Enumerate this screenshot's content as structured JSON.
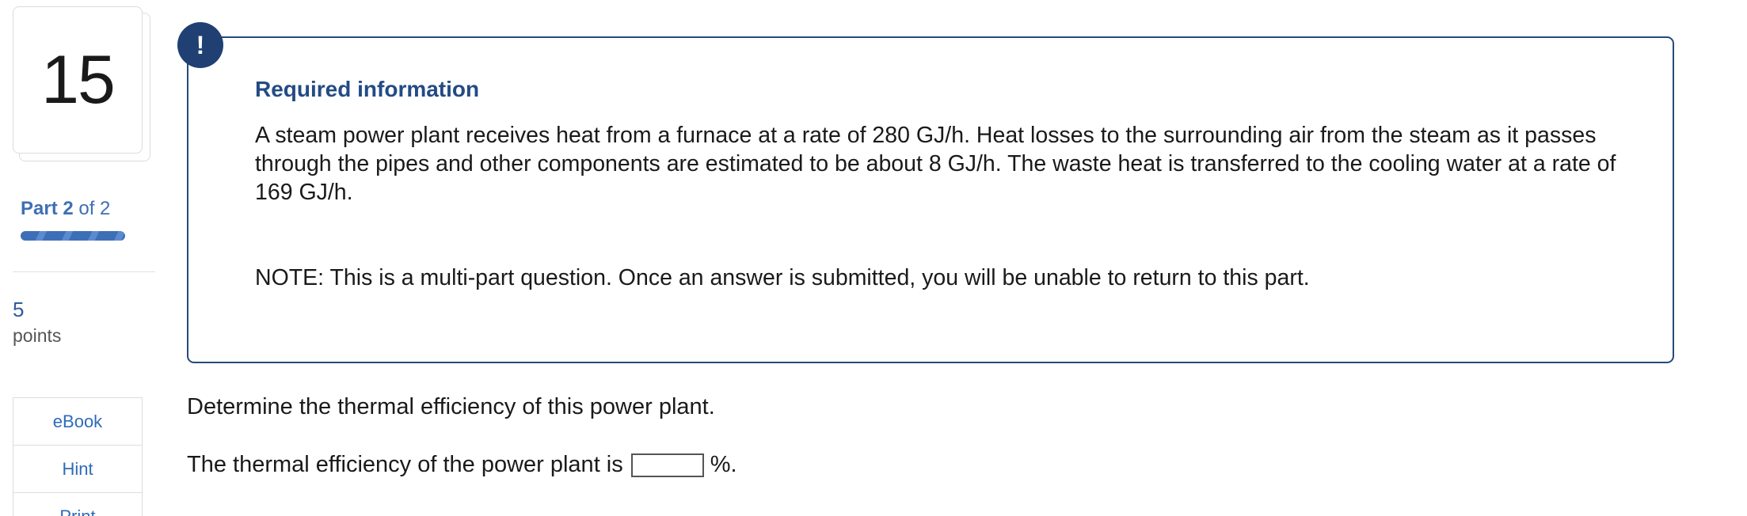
{
  "question": {
    "number": "15",
    "part_current": "Part 2",
    "part_total": "of 2",
    "points_value": "5",
    "points_label": "points"
  },
  "tools": [
    {
      "label": "eBook"
    },
    {
      "label": "Hint"
    },
    {
      "label": "Print"
    }
  ],
  "info": {
    "badge": "!",
    "title": "Required information",
    "text": "A steam power plant receives heat from a furnace at a rate of 280 GJ/h. Heat losses to the surrounding air from the steam as it passes through the pipes and other components are estimated to be about 8 GJ/h. The waste heat is transferred to the cooling water at a rate of 169 GJ/h.",
    "note": "NOTE: This is a multi-part question. Once an answer is submitted, you will be unable to return to this part."
  },
  "prompt": {
    "question_text": "Determine the thermal efficiency of this power plant.",
    "answer_prefix": "The thermal efficiency of the power plant is",
    "answer_value": "",
    "answer_suffix": "%."
  },
  "colors": {
    "accent": "#234b85",
    "link": "#2f6bb8",
    "badge": "#203f73"
  }
}
